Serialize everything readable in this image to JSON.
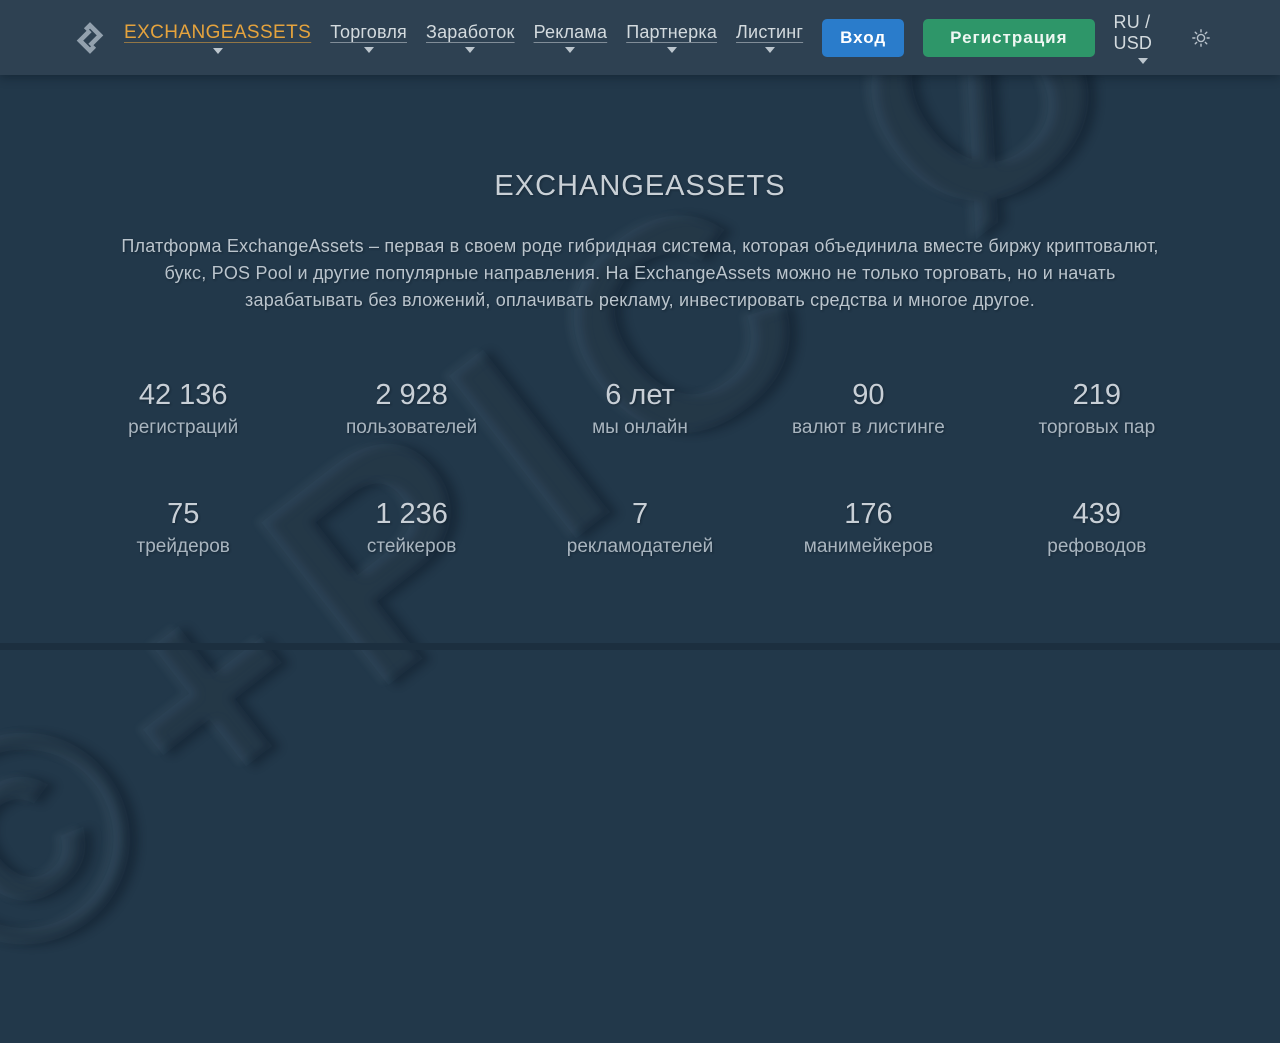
{
  "header": {
    "brand": "EXCHANGEASSETS",
    "menu": [
      {
        "label": "Торговля"
      },
      {
        "label": "Заработок"
      },
      {
        "label": "Реклама"
      },
      {
        "label": "Партнерка"
      },
      {
        "label": "Листинг"
      }
    ],
    "login_label": "Вход",
    "register_label": "Регистрация",
    "locale": "RU / USD"
  },
  "hero": {
    "title": "EXCHANGEASSETS",
    "description": "Платформа ExchangeAssets – первая в своем роде гибридная система, которая объединила вместе биржу криптовалют, букс, POS Pool и другие популярные направления. На ExchangeAssets можно не только торговать, но и начать зарабатывать без вложений, оплачивать рекламу, инвестировать средства и многое другое."
  },
  "stats": {
    "row1": [
      {
        "value": "42 136",
        "label": "регистраций"
      },
      {
        "value": "2 928",
        "label": "пользователей"
      },
      {
        "value": "6 лет",
        "label": "мы онлайн"
      },
      {
        "value": "90",
        "label": "валют в листинге"
      },
      {
        "value": "219",
        "label": "торговых пар"
      }
    ],
    "row2": [
      {
        "value": "75",
        "label": "трейдеров"
      },
      {
        "value": "1 236",
        "label": "стейкеров"
      },
      {
        "value": "7",
        "label": "рекламодателей"
      },
      {
        "value": "176",
        "label": "манимейкеров"
      },
      {
        "value": "439",
        "label": "рефоводов"
      }
    ]
  },
  "watermark": {
    "text": "©+PIC Ø"
  },
  "colors": {
    "accent_brand": "#e5a33d",
    "login_button": "#2a7ccb",
    "register_button": "#2e9669",
    "header_bg": "#2e4152",
    "page_bg": "#22384a"
  }
}
